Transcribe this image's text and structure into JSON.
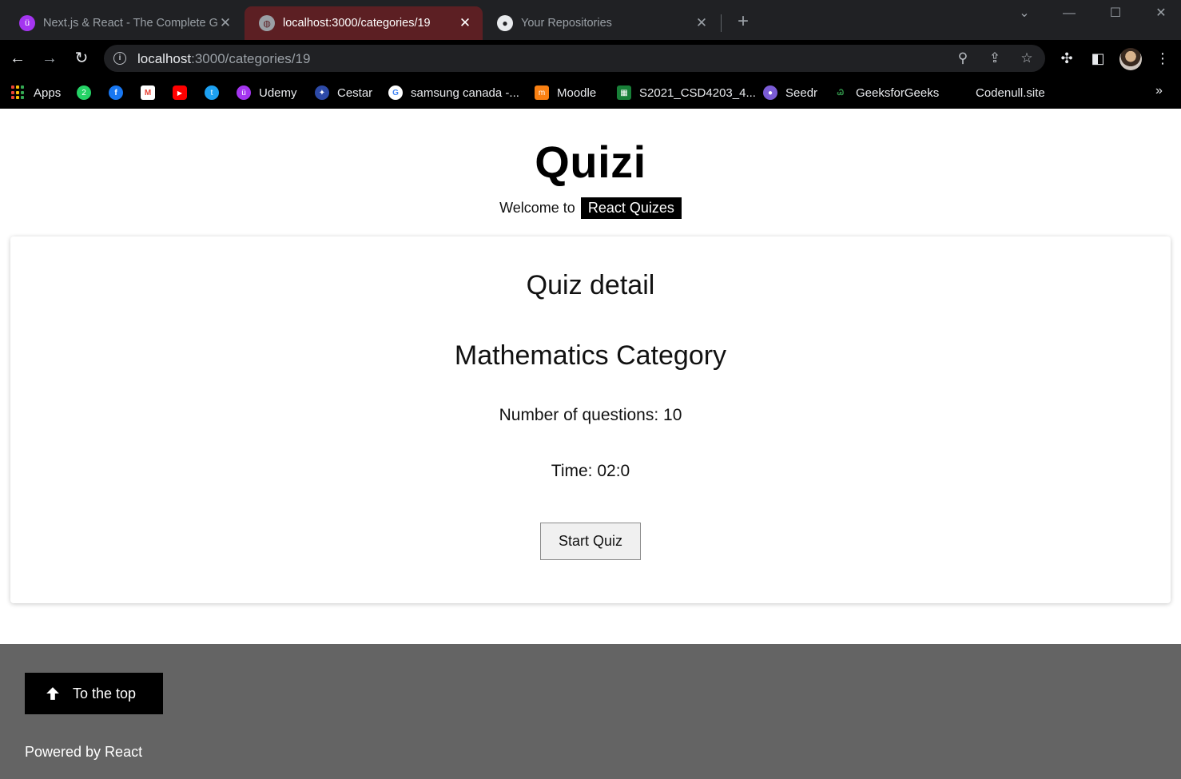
{
  "browser": {
    "tabs": [
      {
        "title": "Next.js & React - The Complete G",
        "icon": "udemy-icon",
        "active": false
      },
      {
        "title": "localhost:3000/categories/19",
        "icon": "globe-icon",
        "active": true
      },
      {
        "title": "Your Repositories",
        "icon": "github-icon",
        "active": false
      }
    ],
    "address": {
      "host": "localhost",
      "path": ":3000/categories/19"
    },
    "bookmarks": [
      {
        "label": "Apps",
        "icon": "apps-grid-icon"
      },
      {
        "label": "",
        "icon": "whatsapp-icon"
      },
      {
        "label": "",
        "icon": "facebook-icon"
      },
      {
        "label": "",
        "icon": "gmail-icon"
      },
      {
        "label": "",
        "icon": "youtube-icon"
      },
      {
        "label": "",
        "icon": "twitter-icon"
      },
      {
        "label": "Udemy",
        "icon": "udemy-icon"
      },
      {
        "label": "Cestar",
        "icon": "cestar-icon"
      },
      {
        "label": "samsung canada -...",
        "icon": "google-icon"
      },
      {
        "label": "Moodle",
        "icon": "moodle-icon"
      },
      {
        "label": "S2021_CSD4203_4...",
        "icon": "sheet-icon"
      },
      {
        "label": "Seedr",
        "icon": "seedr-icon"
      },
      {
        "label": "GeeksforGeeks",
        "icon": "geeksforgeeks-icon"
      },
      {
        "label": "Codenull.site",
        "icon": ""
      }
    ],
    "more_bookmarks": "»"
  },
  "app": {
    "title": "Quizi",
    "welcome_prefix": "Welcome to",
    "welcome_badge": "React Quizes"
  },
  "quiz": {
    "heading": "Quiz detail",
    "category": "Mathematics Category",
    "questions_line": "Number of questions: 10",
    "time_line": "Time: 02:0",
    "start_label": "Start Quiz"
  },
  "footer": {
    "to_top_label": "To the top",
    "powered_by": "Powered by React",
    "background": "#646464"
  }
}
